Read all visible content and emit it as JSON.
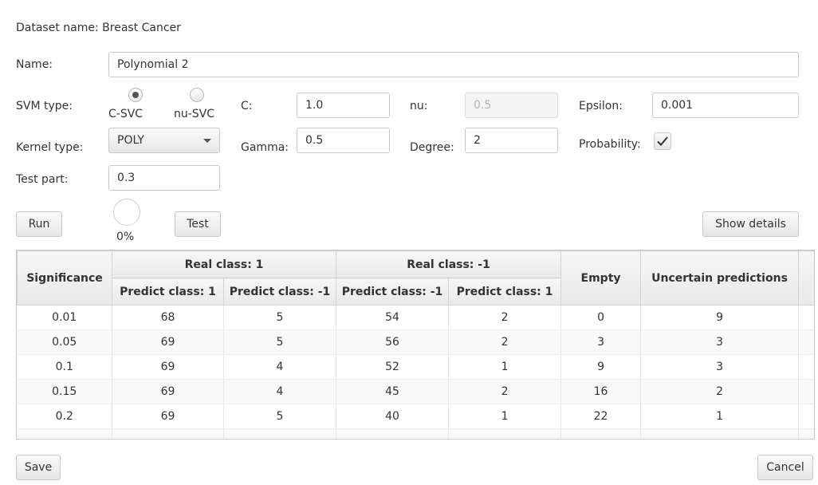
{
  "dataset": {
    "label": "Dataset name:",
    "value": "Breast Cancer"
  },
  "name": {
    "label": "Name:",
    "value": "Polynomial 2"
  },
  "svm_type": {
    "label": "SVM type:",
    "options": [
      "C-SVC",
      "nu-SVC"
    ],
    "selected": "C-SVC"
  },
  "c": {
    "label": "C:",
    "value": "1.0"
  },
  "nu": {
    "label": "nu:",
    "value": "0.5"
  },
  "epsilon": {
    "label": "Epsilon:",
    "value": "0.001"
  },
  "kernel_type": {
    "label": "Kernel type:",
    "value": "POLY"
  },
  "gamma": {
    "label": "Gamma:",
    "value": "0.5"
  },
  "degree": {
    "label": "Degree:",
    "value": "2"
  },
  "probability": {
    "label": "Probability:",
    "checked": true
  },
  "test_part": {
    "label": "Test part:",
    "value": "0.3"
  },
  "buttons": {
    "run": "Run",
    "test": "Test",
    "show_details": "Show details",
    "save": "Save",
    "cancel": "Cancel"
  },
  "progress": {
    "text": "0%",
    "value": 0
  },
  "table": {
    "headers": {
      "significance": "Significance",
      "real_class_1": "Real class: 1",
      "real_class_neg1": "Real class: -1",
      "empty": "Empty",
      "uncertain": "Uncertain predictions",
      "sub": [
        "Predict class: 1",
        "Predict class: -1",
        "Predict class: -1",
        "Predict class: 1"
      ]
    },
    "rows": [
      [
        "0.01",
        "68",
        "5",
        "54",
        "2",
        "0",
        "9"
      ],
      [
        "0.05",
        "69",
        "5",
        "56",
        "2",
        "3",
        "3"
      ],
      [
        "0.1",
        "69",
        "4",
        "52",
        "1",
        "9",
        "3"
      ],
      [
        "0.15",
        "69",
        "4",
        "45",
        "2",
        "16",
        "2"
      ],
      [
        "0.2",
        "69",
        "5",
        "40",
        "1",
        "22",
        "1"
      ]
    ]
  }
}
